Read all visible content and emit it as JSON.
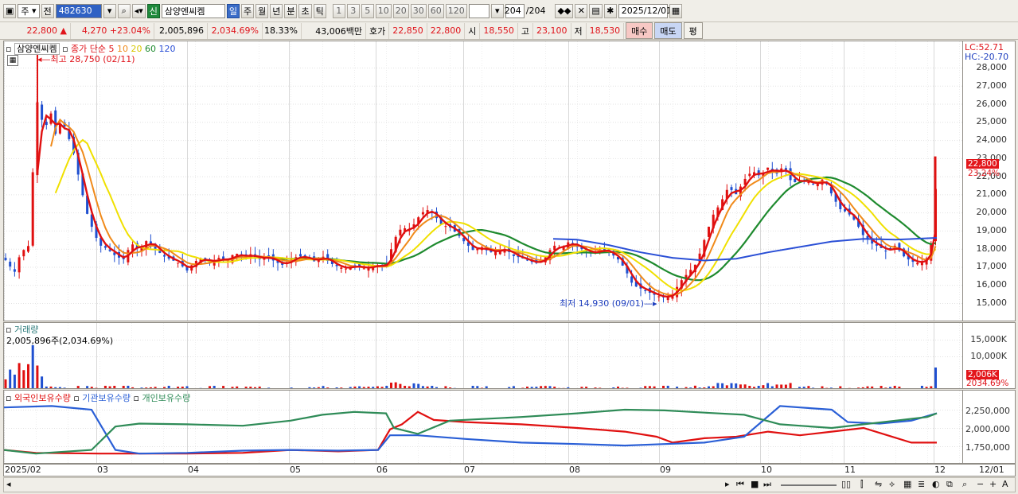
{
  "toolbar": {
    "market": "주",
    "prev": "전",
    "code": "482630",
    "new_badge": "신",
    "stock_name": "삼양엔씨켐",
    "periods": [
      "일",
      "주",
      "월",
      "년",
      "분",
      "초",
      "틱"
    ],
    "active_period": "일",
    "intervals": [
      "1",
      "3",
      "5",
      "10",
      "20",
      "30",
      "60",
      "120"
    ],
    "count": "204",
    "count_total": "/204",
    "date": "2025/12/01"
  },
  "quote": {
    "price": "22,800",
    "change": "4,270",
    "change_pct": "+23.04%",
    "volume": "2,005,896",
    "volume_pct": "2,034.69%",
    "turnover": "18.33%",
    "amount": "43,006백만",
    "ask_label": "호가",
    "ask1": "22,850",
    "ask2": "22,800",
    "open_label": "시",
    "open": "18,550",
    "high_label": "고",
    "high": "23,100",
    "low_label": "저",
    "low": "18,530",
    "buy_btn": "매수",
    "sell_btn": "매도",
    "eval_btn": "평"
  },
  "price_pane": {
    "name": "삼양엔씨켐",
    "ma_label": "종가 단순",
    "ma_periods": [
      "5",
      "10",
      "20",
      "60",
      "120"
    ],
    "ma_colors": [
      "#e01010",
      "#f08a1a",
      "#f0e000",
      "#1e8a2e",
      "#2a4fd6"
    ],
    "high_note": "최고 28,750 (02/11)",
    "low_note": "최저 14,930 (09/01)",
    "lc": "LC:52.71",
    "hc": "HC:-20.70",
    "y_ticks": [
      "28,000",
      "27,000",
      "26,000",
      "25,000",
      "24,000",
      "23,000",
      "22,000",
      "21,000",
      "20,000",
      "19,000",
      "18,000",
      "17,000",
      "16,000",
      "15,000"
    ],
    "last_price": "22,800",
    "last_pct": "23.24%"
  },
  "volume_pane": {
    "title": "거래량",
    "value": "2,005,896주(2,034.69%)",
    "y_ticks": [
      "15,000K",
      "10,000K"
    ],
    "last": "2,006K",
    "last_pct": "2034.69%"
  },
  "holdings_pane": {
    "series": [
      "외국인보유수량",
      "기관보유수량",
      "개인보유수량"
    ],
    "series_colors": [
      "#e01010",
      "#2a5fd6",
      "#2e8b57"
    ],
    "y_ticks": [
      "2,250,000",
      "2,000,000",
      "1,750,000"
    ]
  },
  "x_axis": [
    "2025/02",
    "03",
    "04",
    "05",
    "06",
    "07",
    "08",
    "09",
    "10",
    "11",
    "12",
    "12/01"
  ],
  "chart_data": {
    "type": "line",
    "x": [
      "2025/02",
      "03",
      "04",
      "05",
      "06",
      "07",
      "08",
      "09",
      "10",
      "11",
      "12"
    ],
    "series": [
      {
        "name": "종가",
        "values": [
          17500,
          24000,
          17200,
          17300,
          17200,
          18300,
          17800,
          15500,
          21500,
          17800,
          22800
        ]
      },
      {
        "name": "5",
        "values": [
          17400,
          24500,
          17400,
          17200,
          17100,
          18200,
          17900,
          15600,
          21800,
          17900,
          18500
        ]
      },
      {
        "name": "120",
        "values": [
          null,
          null,
          null,
          null,
          17400,
          17600,
          18500,
          17500,
          18000,
          18500,
          18700
        ]
      }
    ],
    "ylim": [
      14500,
      29000
    ]
  }
}
